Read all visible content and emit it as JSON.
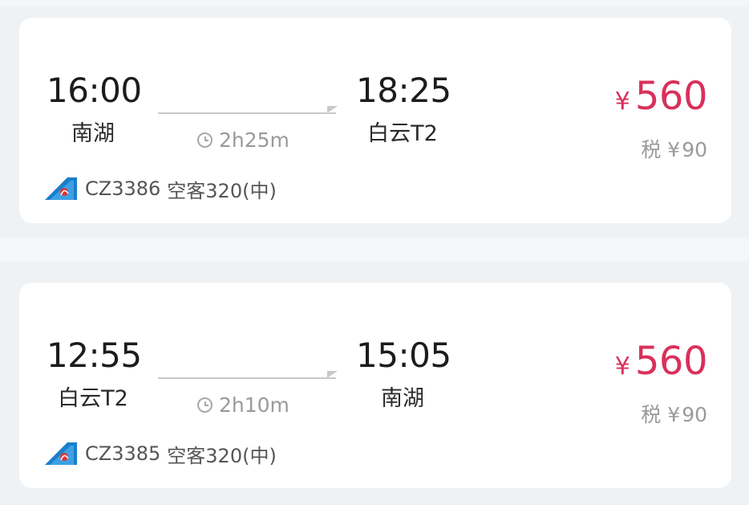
{
  "flights": [
    {
      "departure": {
        "time": "16:00",
        "airport": "南湖"
      },
      "arrival": {
        "time": "18:25",
        "airport": "白云T2"
      },
      "duration": "2h25m",
      "flight_no": "CZ3386",
      "aircraft": "空客320(中)",
      "price": {
        "currency": "¥",
        "amount": "560"
      },
      "tax": {
        "label": "税",
        "currency": "¥",
        "amount": "90"
      }
    },
    {
      "departure": {
        "time": "12:55",
        "airport": "白云T2"
      },
      "arrival": {
        "time": "15:05",
        "airport": "南湖"
      },
      "duration": "2h10m",
      "flight_no": "CZ3385",
      "aircraft": "空客320(中)",
      "price": {
        "currency": "¥",
        "amount": "560"
      },
      "tax": {
        "label": "税",
        "currency": "¥",
        "amount": "90"
      }
    }
  ],
  "colors": {
    "price": "#d9305a",
    "background": "#eef2f5",
    "card": "#ffffff",
    "airline_logo_blue": "#1a7fc9",
    "airline_logo_red": "#e0342f"
  },
  "icons": [
    "clock-icon",
    "airline-logo-icon",
    "route-arrow-icon"
  ]
}
